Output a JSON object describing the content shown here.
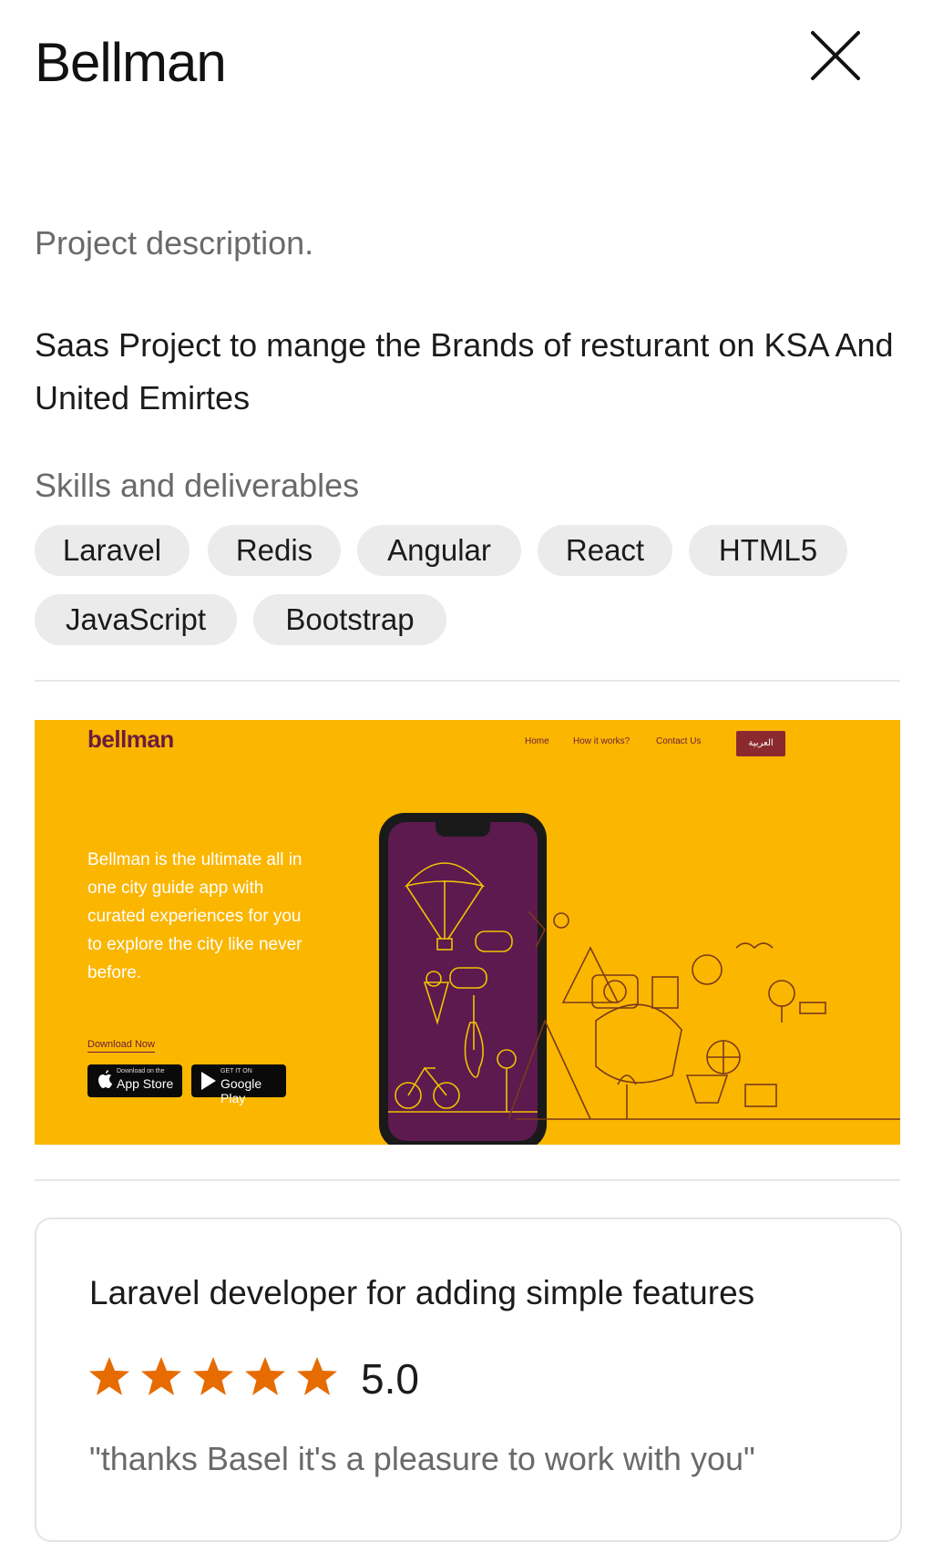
{
  "header": {
    "title": "Bellman"
  },
  "description": {
    "label": "Project description.",
    "text": "Saas Project to mange the Brands of resturant on KSA And United Emirtes"
  },
  "skills": {
    "label": "Skills and deliverables",
    "chips": [
      "Laravel",
      "Redis",
      "Angular",
      "React",
      "HTML5",
      "JavaScript",
      "Bootstrap"
    ]
  },
  "banner": {
    "logo": "bellman",
    "nav": [
      "Home",
      "How it works?",
      "Contact Us"
    ],
    "lang_button": "العربية",
    "tagline": "Bellman is the ultimate all in one city guide app with curated experiences for you to explore the city like never before.",
    "download_label": "Download Now",
    "app_store": {
      "small": "Download on the",
      "big": "App Store"
    },
    "google_play": {
      "small": "GET IT ON",
      "big": "Google Play"
    }
  },
  "review": {
    "title": "Laravel developer for adding simple features",
    "rating": "5.0",
    "stars": 5,
    "quote": "\"thanks Basel it's a pleasure to work with you\""
  },
  "colors": {
    "banner_bg": "#fbb600",
    "brand_purple": "#6b1d3e",
    "star": "#e66b00",
    "chip_bg": "#ebebeb"
  }
}
